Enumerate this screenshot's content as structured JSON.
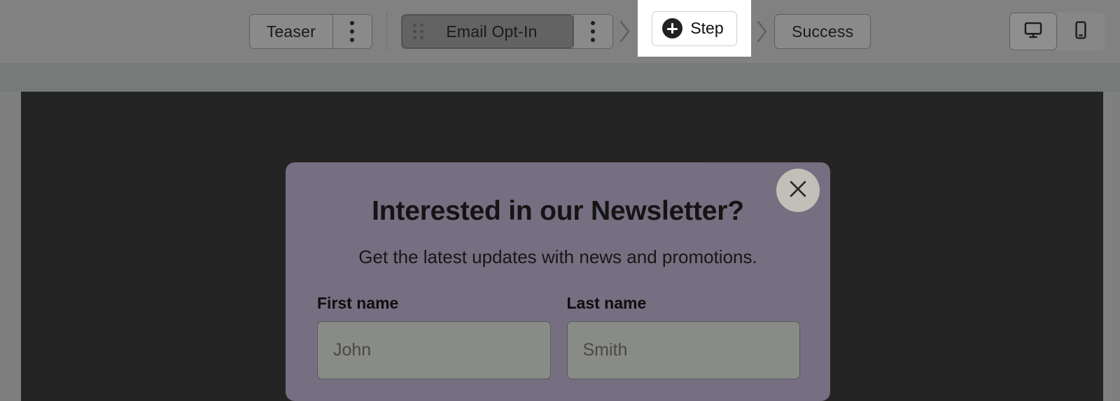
{
  "toolbar": {
    "steps": [
      {
        "label": "Teaser",
        "selected": false,
        "has_drag_handle": false,
        "has_kebab": true,
        "kebab_icon": "kebab-menu-icon"
      },
      {
        "label": "Email Opt-In",
        "selected": true,
        "has_drag_handle": true,
        "has_kebab": true,
        "kebab_icon": "kebab-menu-icon",
        "drag_icon": "drag-handle-icon"
      },
      {
        "label": "Success",
        "selected": false,
        "has_drag_handle": false,
        "has_kebab": false
      }
    ],
    "separator_icon": "chevron-right-icon",
    "add_step": {
      "label": "Step",
      "icon": "plus-circle-icon"
    },
    "device_toggle": {
      "options": [
        {
          "name": "desktop",
          "icon": "desktop-monitor-icon",
          "active": true
        },
        {
          "name": "mobile",
          "icon": "mobile-phone-icon",
          "active": false
        }
      ]
    }
  },
  "modal": {
    "close_icon": "close-x-icon",
    "title": "Interested in our Newsletter?",
    "subtitle": "Get the latest updates with news and promotions.",
    "fields": [
      {
        "label": "First name",
        "value": "",
        "placeholder": "John",
        "name": "first-name"
      },
      {
        "label": "Last name",
        "value": "",
        "placeholder": "Smith",
        "name": "last-name"
      }
    ]
  },
  "colors": {
    "toolbar_bg": "#818181",
    "sub_band_bg": "#767a78",
    "canvas_bg": "#242424",
    "modal_bg": "#7a7285",
    "popover_bg": "#ffffff",
    "accent_dark": "#212121"
  }
}
